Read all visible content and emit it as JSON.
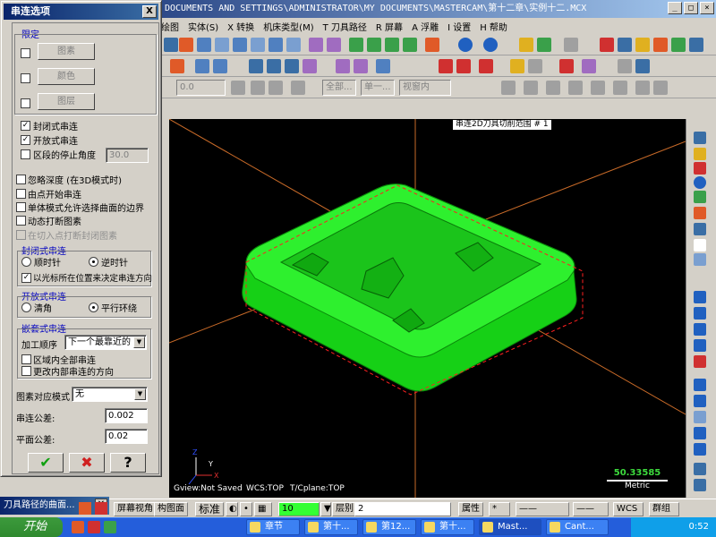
{
  "app": {
    "title": "DOCUMENTS AND SETTINGS\\ADMINISTRATOR\\MY DOCUMENTS\\MASTERCAM\\第十二章\\实例十二.MCX",
    "menu": [
      "绘图",
      "实体(S)",
      "X 转换",
      "机床类型(M)",
      "T 刀具路径",
      "R 屏幕",
      "A 浮雕",
      "I 设置",
      "H 帮助"
    ]
  },
  "toolbar3": {
    "z_value": "0.0",
    "all_label": "全部...",
    "single_label": "单一...",
    "view_label": "视窗内"
  },
  "dialog": {
    "title": "串连选项",
    "close": "X",
    "limit_group": "限定",
    "limit_buttons": [
      "图素",
      "颜色",
      "图层"
    ],
    "closed_chain": "封闭式串连",
    "open_chain": "开放式串连",
    "stop_angle": "区段的停止角度",
    "stop_angle_value": "30.0",
    "ignore_depth": "忽略深度 (在3D模式时)",
    "start_point": "由点开始串连",
    "single_mode": "单体模式允许选择曲面的边界",
    "dynamic_break": "动态打断图素",
    "break_at_point": "在切入点打断封闭图素",
    "closed_group": "封闭式串连",
    "cw": "顺时针",
    "ccw": "逆时针",
    "cursor_dir": "以光标所在位置来决定串连方向",
    "open_group": "开放式串连",
    "clear_corner": "清角",
    "parallel": "平行环绕",
    "nested_group": "嵌套式串连",
    "machining_order_label": "加工顺序",
    "machining_order_value": "下一个最靠近的",
    "all_in_region": "区域内全部串连",
    "change_inner_dir": "更改内部串连的方向",
    "entity_mode_label": "图素对应模式",
    "entity_mode_value": "无",
    "chain_tol_label": "串连公差:",
    "chain_tol_value": "0.002",
    "plane_tol_label": "平面公差:",
    "plane_tol_value": "0.02",
    "ok": "✔",
    "cancel": "✖",
    "help": "?"
  },
  "viewport": {
    "caption": "串连2D刀具切削范围 # 1",
    "gview": "Gview:Not Saved",
    "wcs": "WCS:TOP",
    "tcplane": "T/Cplane:TOP",
    "metric_value": "50.33585",
    "metric_label": "Metric",
    "axis_y": "Y",
    "axis_x": "X",
    "axis_z": "Z"
  },
  "status": {
    "toolpath_window": "刀具路径的曲面...",
    "screen_view": "屏幕视角",
    "construction": "构图面",
    "standard": "标准",
    "z_val": "10",
    "layer_label": "层别",
    "layer_value": "2",
    "attrib": "属性",
    "wcs": "WCS",
    "group": "群组"
  },
  "taskbar": {
    "start": "开始",
    "tasks": [
      "章节",
      "第十...",
      "第12...",
      "第十...",
      "Mast...",
      "Cant..."
    ],
    "clock": "0:52"
  }
}
